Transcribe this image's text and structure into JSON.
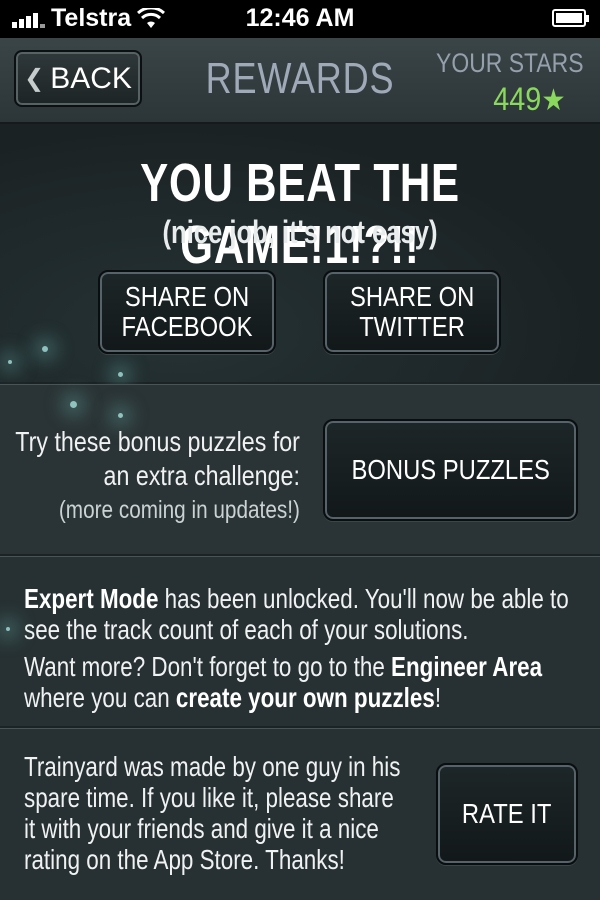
{
  "status_bar": {
    "carrier": "Telstra",
    "time": "12:46 AM"
  },
  "header": {
    "back_label": "BACK",
    "title": "REWARDS",
    "stars_label": "YOUR STARS",
    "stars_count": "449"
  },
  "congrats": {
    "headline": "YOU BEAT THE GAME!1!?!!",
    "subline": "(nice job, it's not easy)",
    "share_facebook": [
      "SHARE ON",
      "FACEBOOK"
    ],
    "share_twitter": [
      "SHARE ON",
      "TWITTER"
    ]
  },
  "bonus": {
    "line1": "Try these bonus puzzles for",
    "line2": "an extra challenge:",
    "line3": "(more coming in updates!)",
    "button": "BONUS PUZZLES"
  },
  "expert": {
    "p1_bold": "Expert Mode",
    "p1_rest1": " has been unlocked.  You'll now be able to",
    "p1_line2": "see the track count of each of your solutions.",
    "p2_start": "Want more? Don't forget to go to the ",
    "p2_bold1": "Engineer Area",
    "p2_mid": "where you can ",
    "p2_bold2": "create your own puzzles",
    "p2_end": "!"
  },
  "credits": {
    "lines": [
      "Trainyard was made by one guy in his",
      "spare time. If you like it, please share",
      "it with your friends and give it a nice",
      "rating on the App Store. Thanks!"
    ],
    "rate_button": "RATE IT"
  }
}
